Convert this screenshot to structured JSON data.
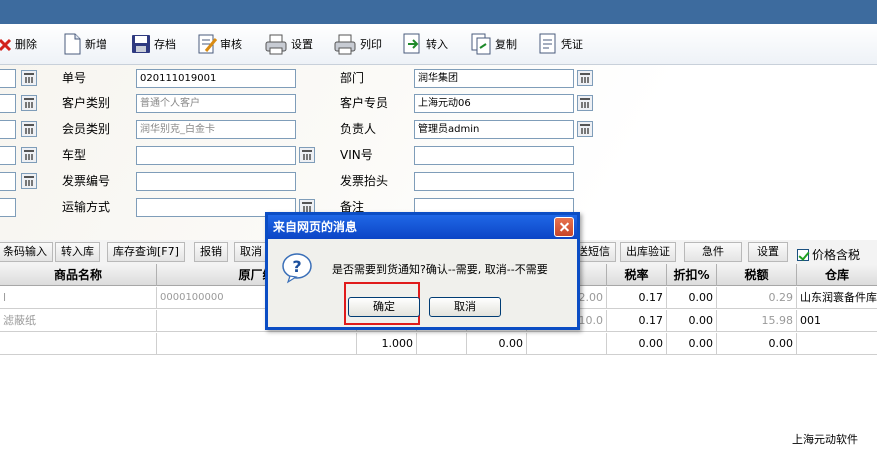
{
  "toolbar": {
    "delete": "删除",
    "new": "新增",
    "save": "存档",
    "audit": "审核",
    "settings": "设置",
    "print": "列印",
    "transfer": "转入",
    "copy": "复制",
    "voucher": "凭证"
  },
  "form": {
    "order_no_label": "单号",
    "order_no": "020111019001",
    "customer_type_label": "客户类别",
    "customer_type": "普通个人客户",
    "member_type_label": "会员类别",
    "member_type": "润华别克_白金卡",
    "car_model_label": "车型",
    "invoice_no_label": "发票编号",
    "shipping_label": "运输方式",
    "dept_label": "部门",
    "dept": "润华集团",
    "customer_rep_label": "客户专员",
    "customer_rep": "上海元动06",
    "owner_label": "负责人",
    "owner": "管理员admin",
    "vin_label": "VIN号",
    "invoice_title_label": "发票抬头",
    "remark_label": "备注"
  },
  "buttons": {
    "barcode": "条码输入",
    "transfer_in": "转入库",
    "stock_query": "库存查询[F7]",
    "report_loss": "报销",
    "cancel": "取消",
    "send_sms": "送短信",
    "out_verify": "出库验证",
    "urgent": "急件",
    "settings": "设置",
    "price_tax": "价格含税"
  },
  "grid": {
    "headers": {
      "product_name": "商品名称",
      "factory_no": "原厂编",
      "tax_rate": "税率",
      "discount": "折扣%",
      "tax_amount": "税额",
      "warehouse": "仓库"
    },
    "rows": [
      {
        "name": "l",
        "factory": "0000100000",
        "price": "2.00",
        "tax_rate": "0.17",
        "discount": "0.00",
        "tax_amount": "0.29",
        "warehouse": "山东润寰备件库"
      },
      {
        "name": "滤蔽纸",
        "factory": "",
        "price": "10.0",
        "tax_rate": "0.17",
        "discount": "0.00",
        "tax_amount": "15.98",
        "warehouse": "001"
      },
      {
        "qty": "1.000",
        "amount": "0.00",
        "tax_rate": "0.00",
        "discount": "0.00",
        "tax_amount": "0.00"
      }
    ]
  },
  "dialog": {
    "title": "来自网页的消息",
    "message": "是否需要到货通知?确认--需要, 取消--不需要",
    "ok": "确定",
    "cancel": "取消"
  },
  "footer": "上海元动软件",
  "colors": {
    "titlebar": "#3d6b9e",
    "dialog_title": "#0c45c6",
    "highlight": "#e01b1b"
  }
}
